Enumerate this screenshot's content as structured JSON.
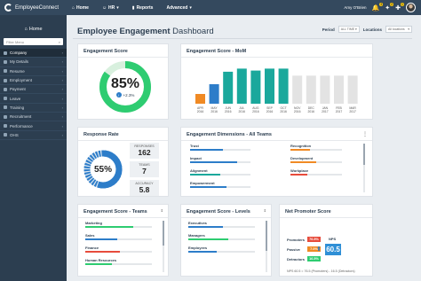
{
  "app": {
    "name": "EmployeeConnect",
    "nav": [
      {
        "label": "Home",
        "icon": "home-icon"
      },
      {
        "label": "HR",
        "icon": "people-icon"
      },
      {
        "label": "Reports",
        "icon": "chart-icon"
      },
      {
        "label": "Advanced",
        "icon": "none"
      }
    ],
    "user": "Amy O'Brien",
    "notifications": [
      "3",
      "2",
      "1"
    ]
  },
  "sidebar": {
    "home": "Home",
    "filter_placeholder": "Filter Menu",
    "items": [
      {
        "label": "Company"
      },
      {
        "label": "My Details"
      },
      {
        "label": "Resume"
      },
      {
        "label": "Employment"
      },
      {
        "label": "Payment"
      },
      {
        "label": "Leave"
      },
      {
        "label": "Training"
      },
      {
        "label": "Recruitment"
      },
      {
        "label": "Performance"
      },
      {
        "label": "OHS"
      }
    ]
  },
  "header": {
    "title_bold": "Employee Engagement",
    "title_rest": " Dashboard",
    "period_label": "Period",
    "period_value": "ALL TIME",
    "locations_label": "Locations",
    "locations_value": "All locations"
  },
  "engagement_score": {
    "title": "Engagement Score",
    "value": "85%",
    "delta": "+2.3%",
    "fraction": 0.85,
    "color": "#2ecc71"
  },
  "mom": {
    "title": "Engagement Score - MoM",
    "chart_data": {
      "type": "bar",
      "categories": [
        "APR 2016",
        "MAY 2016",
        "JUN 2016",
        "JUL 2016",
        "AUG 2016",
        "SEP 2016",
        "OCT 2016",
        "NOV 2016",
        "DEC 2016",
        "JAN 2017",
        "FEB 2017",
        "MAR 2017"
      ],
      "values": [
        25,
        50,
        82,
        90,
        85,
        90,
        90,
        72,
        72,
        72,
        72,
        72
      ],
      "colors": [
        "#f08a24",
        "#2d7dc9",
        "#1aa89c",
        "#1aa89c",
        "#1aa89c",
        "#1aa89c",
        "#1aa89c",
        "#e3e3e3",
        "#e3e3e3",
        "#e3e3e3",
        "#e3e3e3",
        "#e3e3e3"
      ],
      "ylim": [
        0,
        100
      ]
    }
  },
  "response_rate": {
    "title": "Response Rate",
    "value": "55%",
    "fraction": 0.55,
    "stats": [
      {
        "label": "RESPONSES",
        "value": "162"
      },
      {
        "label": "TEAMS",
        "value": "7"
      },
      {
        "label": "ACCURACY",
        "value": "5.8"
      }
    ]
  },
  "dimensions": {
    "title": "Engagement Dimensions - All Teams",
    "left": [
      {
        "label": "Trust",
        "value": 0.55,
        "color": "#2d7dc9"
      },
      {
        "label": "Impact",
        "value": 0.78,
        "color": "#2d7dc9"
      },
      {
        "label": "Alignment",
        "value": 0.5,
        "color": "#1aa89c"
      },
      {
        "label": "Empowerment",
        "value": 0.6,
        "color": "#2d7dc9"
      }
    ],
    "right": [
      {
        "label": "Recognition",
        "value": 0.38,
        "color": "#f08a24"
      },
      {
        "label": "Development",
        "value": 0.5,
        "color": "#f08a24"
      },
      {
        "label": "Workplace",
        "value": 0.32,
        "color": "#e74c3c"
      }
    ]
  },
  "teams": {
    "title": "Engagement Score - Teams",
    "rows": [
      {
        "label": "Marketing",
        "value": 0.72,
        "color": "#2ecc71"
      },
      {
        "label": "Sales",
        "value": 0.48,
        "color": "#2d7dc9"
      },
      {
        "label": "Finance",
        "value": 0.52,
        "color": "#e74c3c"
      },
      {
        "label": "Human Resources",
        "value": 0.4,
        "color": "#2ecc71"
      }
    ]
  },
  "levels": {
    "title": "Engagement Score - Levels",
    "rows": [
      {
        "label": "Executives",
        "value": 0.52,
        "color": "#2d7dc9"
      },
      {
        "label": "Managers",
        "value": 0.6,
        "color": "#2ecc71"
      },
      {
        "label": "Employees",
        "value": 0.42,
        "color": "#2d7dc9"
      }
    ]
  },
  "nps": {
    "title": "Net Promoter Score",
    "rows": [
      {
        "label": "Promoters",
        "pct": "76.5%",
        "color": "#e74c3c"
      },
      {
        "label": "Passive",
        "pct": "7.0%",
        "color": "#f08a24"
      },
      {
        "label": "Detractors",
        "pct": "16.5%",
        "color": "#2ecc71"
      }
    ],
    "nps_label": "NPS",
    "value": "60.5",
    "footnote": "NPS 60.5 = 76.5 (Promoters) - 16.5 (Detractors)"
  }
}
